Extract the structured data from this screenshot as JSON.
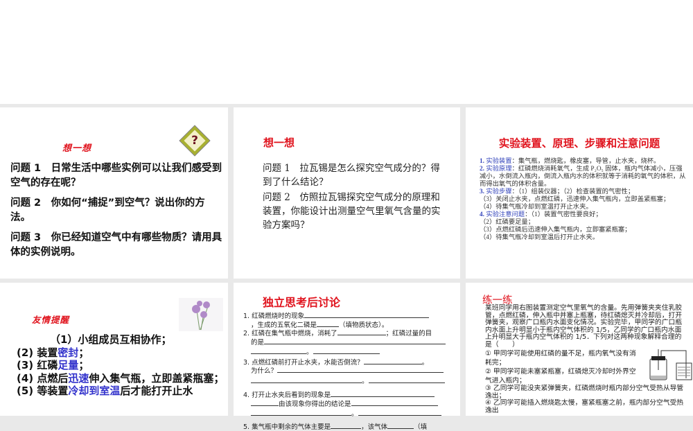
{
  "slides": [
    {
      "title": "想一想",
      "questions": [
        "问题 1　日常生活中哪些实例可以让我们感受到空气的存在呢？",
        "问题 2　你如何“捕捉”到空气？说出你的方法。",
        "问题 3　你已经知道空气中有哪些物质？请用具体的实例说明。"
      ],
      "icon": "question-mark-icon"
    },
    {
      "title": "想一想",
      "questions": [
        "问题 1　拉瓦锡是怎么探究空气成分的？得到了什么结论？",
        "问题 2　仿照拉瓦锡探究空气成分的原理和装置，你能设计出测量空气里氧气含量的实验方案吗？"
      ]
    },
    {
      "title": "实验装置、原理、步骤和注意问题",
      "items": [
        {
          "num": "1.",
          "label": "实验装置",
          "text": "：集气瓶，燃烧匙，橡皮塞，导管，止水夹，烧杯。"
        },
        {
          "num": "2.",
          "label": "实验原理",
          "text": "：红磷燃烧消耗氧气，生成 P₂O₅ 固体，瓶内气体减小，压强减小，水倒流入瓶内，倒流入瓶内水的体积就等于消耗的氧气的体积，从而得出氧气的体积含量。"
        },
        {
          "num": "3.",
          "label": "实验步骤",
          "text": "：（1）组装仪器；（2）检查装置的气密性；"
        },
        {
          "num": "",
          "label": "",
          "text": "（3）关闭止水夹，点燃红磷，迅速伸入集气瓶内，立即盖紧瓶塞；"
        },
        {
          "num": "",
          "label": "",
          "text": "（4）待集气瓶冷却到室温打开止水夹。"
        },
        {
          "num": "4.",
          "label": "实验注意问题",
          "text": "：（1）装置气密性要良好；"
        },
        {
          "num": "",
          "label": "",
          "text": "（2）红磷要足量；"
        },
        {
          "num": "",
          "label": "",
          "text": "（3）点燃红磷后迅速伸入集气瓶内，立即塞紧瓶塞；"
        },
        {
          "num": "",
          "label": "",
          "text": "（4）待集气瓶冷却到室温后打开止水夹。"
        }
      ]
    },
    {
      "title": "友情提醒",
      "items": [
        {
          "pre": "（1）小组成员互相协作；",
          "hl": "",
          "post": ""
        },
        {
          "pre": "(2) 装置",
          "hl": "密封",
          "post": "；"
        },
        {
          "pre": "(3) 红磷",
          "hl": "足量",
          "post": "；"
        },
        {
          "pre": "(4) 点燃后",
          "hl": "迅速",
          "post": "伸入集气瓶，立即盖紧瓶塞；"
        },
        {
          "pre": "(5) 等装置",
          "hl": "冷却到室温",
          "post": "后才能打开止水"
        }
      ]
    },
    {
      "title": "独立思考后讨论",
      "lines": {
        "l1a": "1.  红磷燃烧时的现象",
        "l1b": "，生成的五氧化二磷是",
        "l1c": "（填物质状态）。",
        "l2a": "2.  红磷在集气瓶中燃烧，消耗了",
        "l2b": "；红磷过量的目",
        "l2c": "的是",
        "l3a": "3.  点燃红磷前打开止水夹，水能否倒流？",
        "l3b": "为什么？",
        "l4a": "4.  打开止水夹后看到的现象是",
        "l4b": "由该现象你得出的结论是",
        "l5a": "5.  集气瓶中剩余的气体主要是",
        "l5b": "，该气体",
        "l5c": "（填",
        "dot": "。"
      }
    },
    {
      "title": "练一练",
      "body": "某班同学用右图装置测定空气里氧气的含量。先用弹簧夹夹住乳胶管，点燃红磷，伸入瓶中并塞上瓶塞，待红磷熄灭并冷却后，打开弹簧夹，观察广口瓶内水面变化情况。实验完毕，甲同学的广口瓶内水面上升明显小于瓶内空气体积的 1/5，乙同学的广口瓶内水面上升明显大于瓶内空气体积的 1/5．下列对这两种现象解释合理的是（　　）",
      "options": [
        "① 甲同学可能使用红磷的量不足，瓶内氧气没有消耗完；",
        "② 甲同学可能未塞紧瓶塞，红磷熄灭冷却时外界空气进入瓶内；",
        "③ 乙同学可能没夹紧弹簧夹，红磷燃烧时瓶内部分空气受热从导管逸出；",
        "④ 乙同学可能插入燃烧匙太慢，塞紧瓶塞之前，瓶内部分空气受热逸出"
      ]
    }
  ]
}
